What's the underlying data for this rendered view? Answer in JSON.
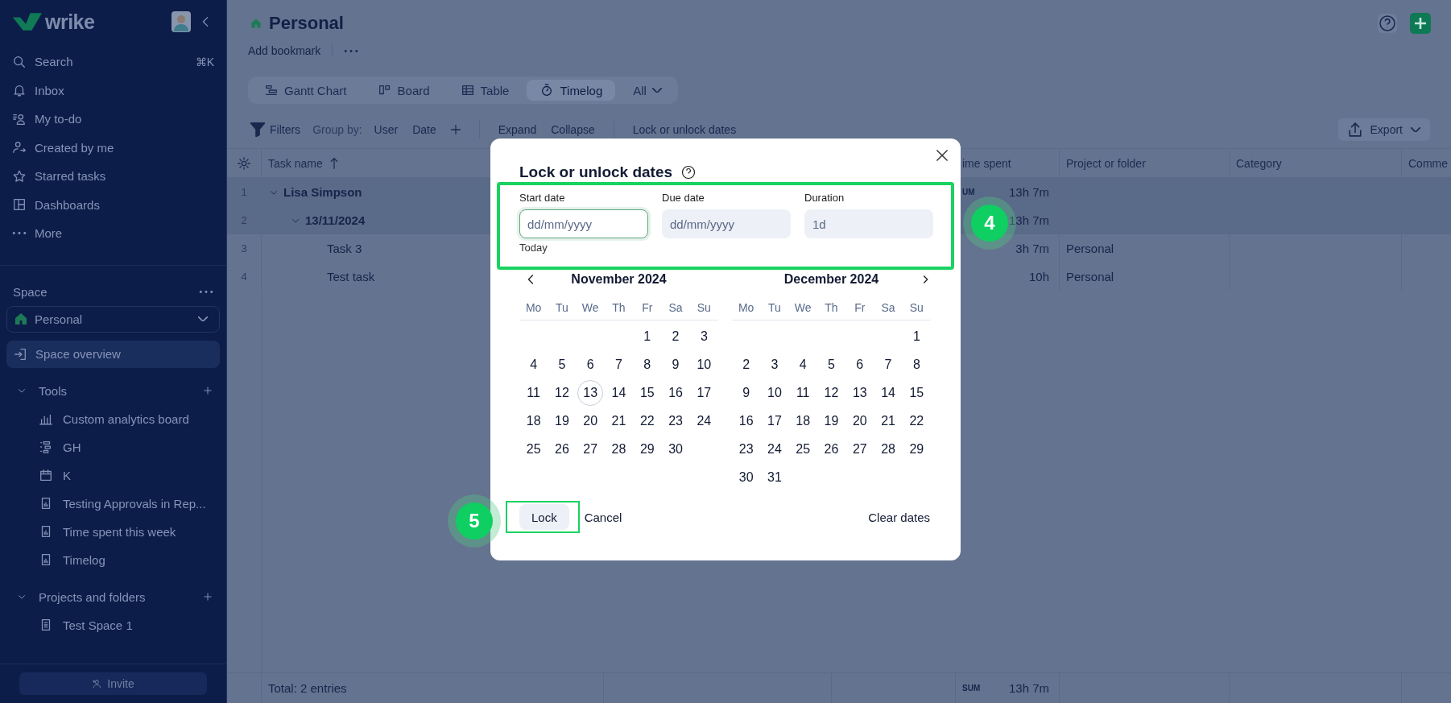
{
  "sidebar": {
    "logo": "wrike",
    "nav": [
      {
        "label": "Search",
        "shortcut": "⌘K",
        "selected": false
      },
      {
        "label": "Inbox",
        "selected": false
      },
      {
        "label": "My to-do",
        "selected": false
      },
      {
        "label": "Created by me",
        "selected": false
      },
      {
        "label": "Starred tasks",
        "selected": false
      },
      {
        "label": "Dashboards",
        "selected": false
      },
      {
        "label": "More",
        "selected": false
      }
    ],
    "space_label": "Space",
    "space": "Personal",
    "overview": {
      "label": "Space overview",
      "selected": true
    },
    "sections": [
      {
        "label": "Tools",
        "expanded": true,
        "items": [
          "Custom analytics board",
          "GH",
          "K",
          "Testing Approvals in Rep...",
          "Time spent this week",
          "Timelog"
        ]
      },
      {
        "label": "Projects and folders",
        "expanded": true,
        "items": [
          "Test Space 1"
        ]
      }
    ],
    "invite": "Invite"
  },
  "header": {
    "title": "Personal",
    "bookmark": "Add bookmark"
  },
  "views": [
    {
      "label": "Gantt Chart",
      "selected": false
    },
    {
      "label": "Board",
      "selected": false
    },
    {
      "label": "Table",
      "selected": false
    },
    {
      "label": "Timelog",
      "selected": true
    }
  ],
  "view_filter": "All",
  "toolbar": {
    "filters": "Filters",
    "group_by": "Group by:",
    "groups": [
      "User",
      "Date"
    ],
    "actions": [
      "Expand",
      "Collapse"
    ],
    "lock": "Lock or unlock dates",
    "export": "Export"
  },
  "table": {
    "columns": [
      {
        "label": "Task name",
        "sorted": true
      },
      {
        "label": "ime spent"
      },
      {
        "label": "Project or folder"
      },
      {
        "label": "Category"
      },
      {
        "label": "Comme"
      }
    ],
    "rows": [
      {
        "num": "1",
        "name": "Lisa Simpson",
        "kind": "group",
        "expanded": true,
        "sum_label": "UM",
        "time": "13h 7m",
        "children": [
          {
            "num": "2",
            "name": "13/11/2024",
            "kind": "group",
            "expanded": true,
            "time": "13h 7m",
            "children": [
              {
                "num": "3",
                "name": "Task 3",
                "kind": "task",
                "time": "3h 7m",
                "project": "Personal"
              },
              {
                "num": "4",
                "name": "Test task",
                "kind": "task",
                "time": "10h",
                "project": "Personal"
              }
            ]
          }
        ]
      }
    ],
    "footer": {
      "total": "Total: 2 entries",
      "sum_label": "SUM",
      "time": "13h 7m"
    }
  },
  "modal": {
    "title": "Lock or unlock dates",
    "fields_callout": "4",
    "actions_callout": "5",
    "fields": [
      {
        "label": "Start date",
        "placeholder": "dd/mm/yyyy",
        "focused": true
      },
      {
        "label": "Due date",
        "placeholder": "dd/mm/yyyy",
        "focused": false
      },
      {
        "label": "Duration",
        "value": "1d",
        "focused": false
      }
    ],
    "hint": "Today",
    "months": [
      {
        "title": "November 2024",
        "weekdays": [
          "Mo",
          "Tu",
          "We",
          "Th",
          "Fr",
          "Sa",
          "Su"
        ],
        "weeks": [
          [
            "1",
            "2",
            "3"
          ],
          [
            "4",
            "5",
            "6",
            "7",
            "8",
            "9",
            "10"
          ],
          [
            "11",
            "12",
            {
              "day": "13",
              "today": true
            },
            "14",
            "15",
            "16",
            "17"
          ],
          [
            "18",
            "19",
            "20",
            "21",
            "22",
            "23",
            "24"
          ],
          [
            "25",
            "26",
            "27",
            "28",
            "29",
            "30"
          ]
        ]
      },
      {
        "title": "December 2024",
        "weekdays": [
          "Mo",
          "Tu",
          "We",
          "Th",
          "Fr",
          "Sa",
          "Su"
        ],
        "weeks": [
          [
            "1"
          ],
          [
            "2",
            "3",
            "4",
            "5",
            "6",
            "7",
            "8"
          ],
          [
            "9",
            "10",
            "11",
            "12",
            "13",
            "14",
            "15"
          ],
          [
            "16",
            "17",
            "18",
            "19",
            "20",
            "21",
            "22"
          ],
          [
            "23",
            "24",
            "25",
            "26",
            "27",
            "28",
            "29"
          ],
          [
            "30",
            "31"
          ]
        ]
      }
    ],
    "buttons": [
      {
        "label": "Lock",
        "kind": "primary"
      },
      {
        "label": "Cancel",
        "kind": "link"
      }
    ],
    "clear": "Clear dates"
  }
}
